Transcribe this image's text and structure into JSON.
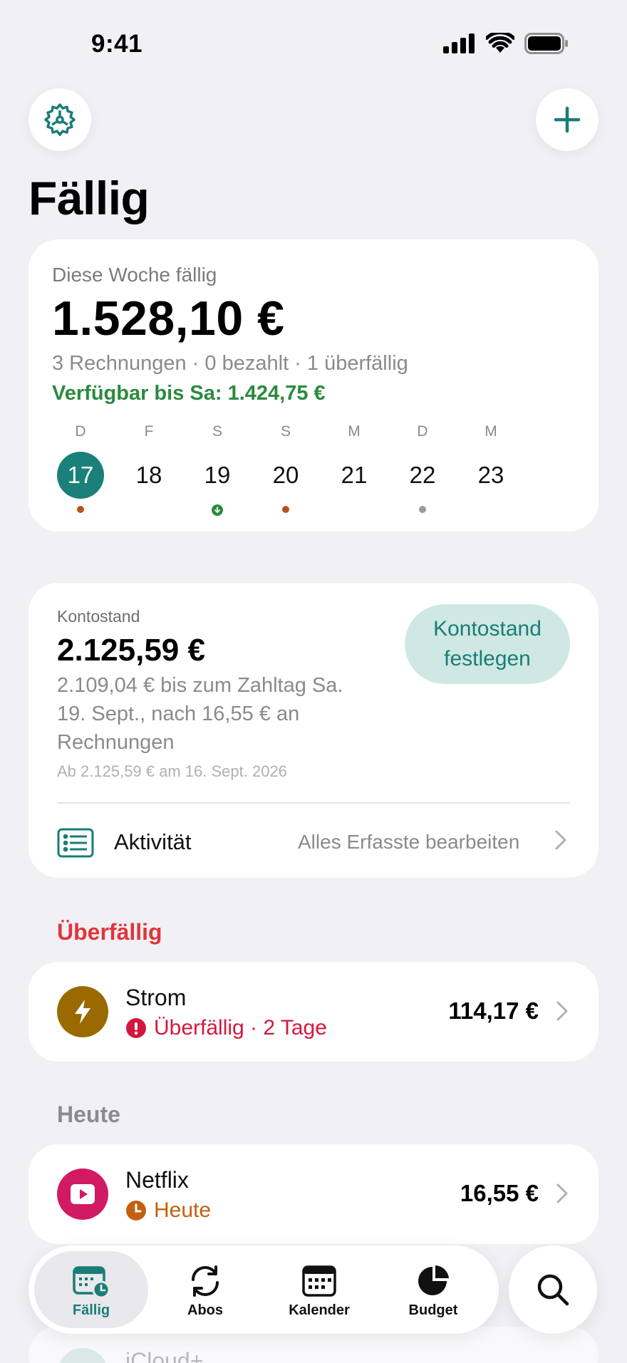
{
  "status_bar": {
    "time": "9:41"
  },
  "header": {
    "title": "Fällig"
  },
  "week": {
    "label": "Diese Woche fällig",
    "total": "1.528,10 €",
    "summary": "3 Rechnungen · 0 bezahlt · 1 überfällig",
    "available": "Verfügbar bis Sa: 1.424,75 €",
    "days": [
      {
        "letter": "D",
        "number": "17",
        "today": true,
        "marker": "orange"
      },
      {
        "letter": "F",
        "number": "18",
        "today": false,
        "marker": "none"
      },
      {
        "letter": "S",
        "number": "19",
        "today": false,
        "marker": "income"
      },
      {
        "letter": "S",
        "number": "20",
        "today": false,
        "marker": "orange"
      },
      {
        "letter": "M",
        "number": "21",
        "today": false,
        "marker": "none"
      },
      {
        "letter": "D",
        "number": "22",
        "today": false,
        "marker": "gray"
      },
      {
        "letter": "M",
        "number": "23",
        "today": false,
        "marker": "none"
      }
    ]
  },
  "balance": {
    "label": "Kontostand",
    "amount": "2.125,59 €",
    "detail": "2.109,04 € bis zum Zahltag Sa. 19. Sept., nach 16,55 € an Rechnungen",
    "since": "Ab 2.125,59 € am 16. Sept. 2026",
    "set_button": "Kontostand festlegen",
    "activity_label": "Aktivität",
    "activity_edit": "Alles Erfasste bearbeiten"
  },
  "sections": {
    "overdue_title": "Überfällig",
    "today_title": "Heute"
  },
  "bills": [
    {
      "name": "Strom",
      "status": "Überfällig · 2 Tage",
      "amount": "114,17 €",
      "icon": "bolt-icon",
      "color": "#9a6a00",
      "status_color": "#d4183d"
    },
    {
      "name": "Netflix",
      "status": "Heute",
      "amount": "16,55 €",
      "icon": "play-icon",
      "color": "#d11a63",
      "status_color": "#c4600f"
    }
  ],
  "ghost": {
    "text": "iCloud+"
  },
  "tabs": [
    {
      "label": "Fällig",
      "icon": "calendar-clock-icon",
      "active": true
    },
    {
      "label": "Abos",
      "icon": "refresh-icon",
      "active": false
    },
    {
      "label": "Kalender",
      "icon": "calendar-icon",
      "active": false
    },
    {
      "label": "Budget",
      "icon": "pie-chart-icon",
      "active": false
    }
  ],
  "colors": {
    "accent": "#1a8079",
    "overdue": "#e0353b",
    "available": "#2b8a3e"
  }
}
